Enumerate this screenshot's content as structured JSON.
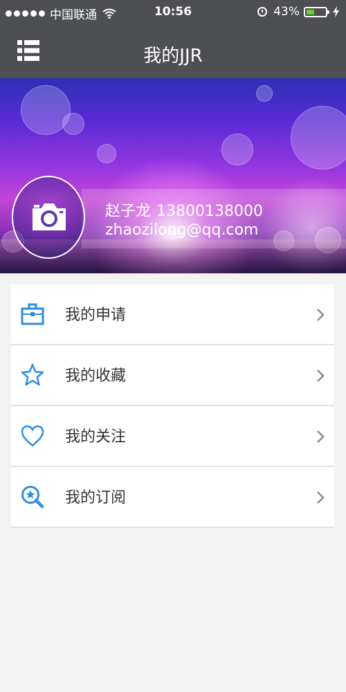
{
  "status_bar": {
    "carrier": "中国联通",
    "time": "10:56",
    "battery_percent": "43%",
    "battery_level": 0.43,
    "icons": [
      "signal-dots-icon",
      "wifi-icon",
      "alarm-icon",
      "battery-icon",
      "charging-bolt-icon"
    ]
  },
  "nav": {
    "title": "我的JJR",
    "menu_icon": "list-icon"
  },
  "profile": {
    "avatar_icon": "camera-icon",
    "name": "赵子龙",
    "phone": "13800138000",
    "email": "zhaozilong@qq.com"
  },
  "menu": {
    "items": [
      {
        "label": "我的申请",
        "icon": "briefcase-icon"
      },
      {
        "label": "我的收藏",
        "icon": "star-icon"
      },
      {
        "label": "我的关注",
        "icon": "heart-icon"
      },
      {
        "label": "我的订阅",
        "icon": "search-star-icon"
      }
    ],
    "chevron_icon": "chevron-right-icon"
  },
  "colors": {
    "nav_background": "#4d4f53",
    "accent_blue": "#2b8ee0",
    "page_background": "#f3f3f3",
    "battery_green": "#6cd035"
  }
}
